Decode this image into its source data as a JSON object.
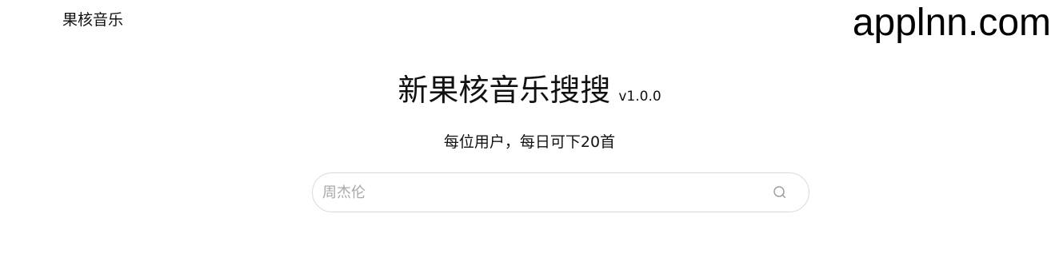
{
  "header": {
    "brand": "果核音乐",
    "watermark": "applnn.com"
  },
  "hero": {
    "title": "新果核音乐搜搜",
    "version": "v1.0.0",
    "subtitle": "每位用户，每日可下20首"
  },
  "search": {
    "placeholder": "周杰伦",
    "value": "",
    "icon": "search-icon"
  },
  "colors": {
    "text": "#111111",
    "placeholder": "#a8a8a8",
    "border": "#d9d9d9",
    "icon": "#9a9a9a"
  }
}
